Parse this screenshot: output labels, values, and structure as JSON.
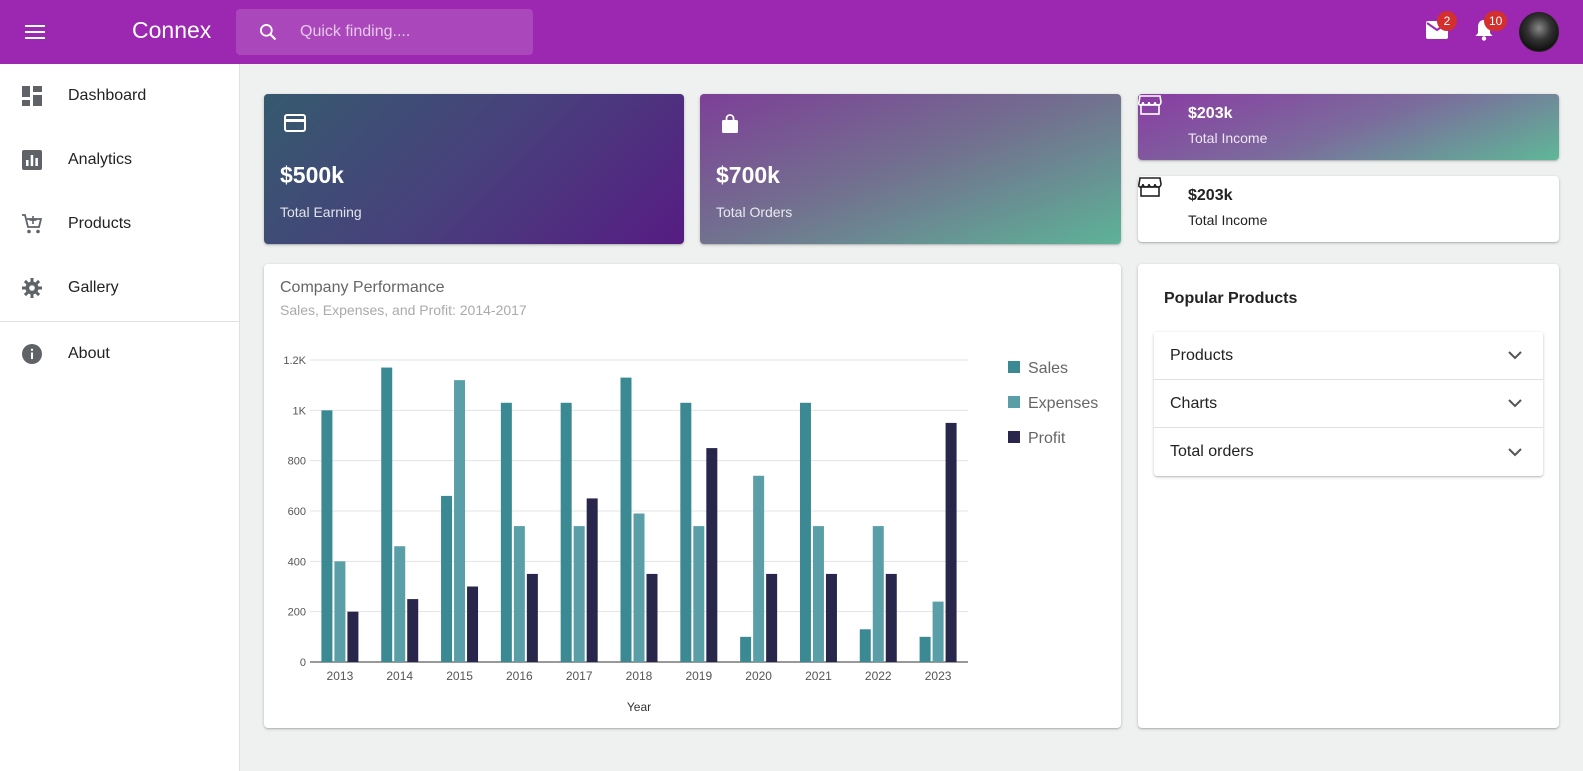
{
  "app": {
    "title": "Connex"
  },
  "search": {
    "placeholder": "Quick finding...."
  },
  "header": {
    "mail_badge": "2",
    "notifications_badge": "10"
  },
  "sidebar": {
    "items": [
      {
        "label": "Dashboard",
        "icon": "dashboard-icon"
      },
      {
        "label": "Analytics",
        "icon": "analytics-icon"
      },
      {
        "label": "Products",
        "icon": "cart-icon"
      },
      {
        "label": "Gallery",
        "icon": "gear-icon"
      },
      {
        "label": "About",
        "icon": "info-icon"
      }
    ]
  },
  "stats": {
    "earning": {
      "value": "$500k",
      "label": "Total Earning",
      "icon": "credit-card-icon"
    },
    "orders": {
      "value": "$700k",
      "label": "Total Orders",
      "icon": "shopping-bag-icon"
    },
    "income1": {
      "value": "$203k",
      "label": "Total Income",
      "icon": "store-icon"
    },
    "income2": {
      "value": "$203k",
      "label": "Total Income",
      "icon": "store-icon"
    }
  },
  "chart": {
    "title": "Company Performance",
    "subtitle": "Sales, Expenses, and Profit: 2014-2017"
  },
  "chart_data": {
    "type": "bar",
    "title": "Company Performance",
    "subtitle": "Sales, Expenses, and Profit: 2014-2017",
    "xlabel": "Year",
    "ylabel": "",
    "categories": [
      "2013",
      "2014",
      "2015",
      "2016",
      "2017",
      "2018",
      "2019",
      "2020",
      "2021",
      "2022",
      "2023"
    ],
    "series": [
      {
        "name": "Sales",
        "color": "#3b8a93",
        "values": [
          1000,
          1170,
          660,
          1030,
          1030,
          1130,
          1030,
          100,
          1030,
          130,
          100
        ]
      },
      {
        "name": "Expenses",
        "color": "#5a9fa8",
        "values": [
          400,
          460,
          1120,
          540,
          540,
          590,
          540,
          740,
          540,
          540,
          240
        ]
      },
      {
        "name": "Profit",
        "color": "#28264b",
        "values": [
          200,
          250,
          300,
          350,
          650,
          350,
          850,
          350,
          350,
          350,
          950
        ]
      }
    ],
    "ylim": [
      0,
      1200
    ],
    "yticks": [
      "0",
      "200",
      "400",
      "600",
      "800",
      "1K",
      "1.2K"
    ],
    "grid": true,
    "legend": "right"
  },
  "popular": {
    "title": "Popular Products",
    "items": [
      {
        "label": "Products"
      },
      {
        "label": "Charts"
      },
      {
        "label": "Total orders"
      }
    ]
  },
  "colors": {
    "primary": "#9c27b0",
    "background": "#eff0f0",
    "badge": "#d32f2f"
  }
}
